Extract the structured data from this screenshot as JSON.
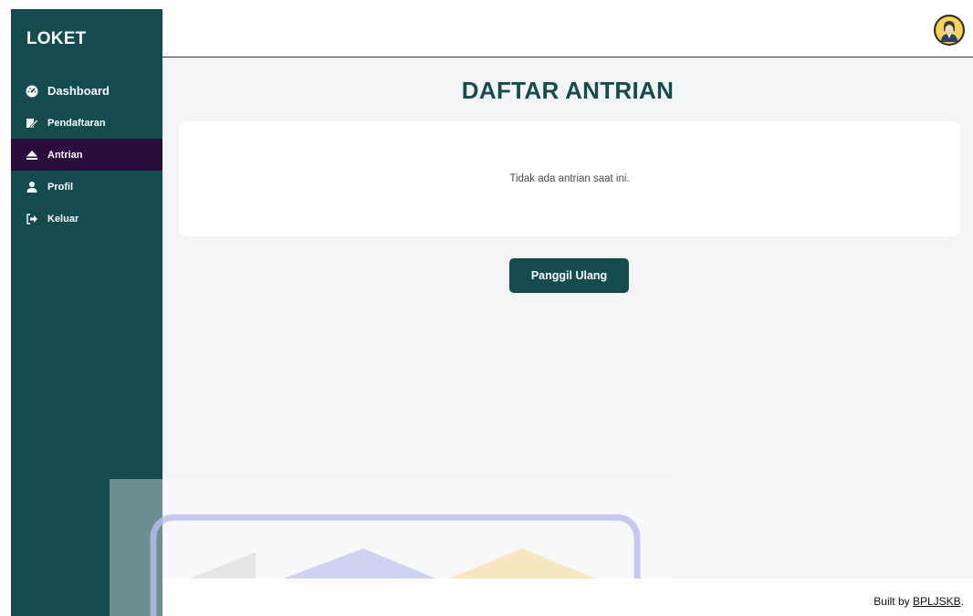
{
  "sidebar": {
    "brand": "LOKET",
    "items": [
      {
        "label": "Dashboard",
        "icon": "tachometer-icon"
      },
      {
        "label": "Pendaftaran",
        "icon": "edit-icon"
      },
      {
        "label": "Antrian",
        "icon": "eject-icon",
        "active": true
      },
      {
        "label": "Profil",
        "icon": "user-icon"
      },
      {
        "label": "Keluar",
        "icon": "sign-out-icon"
      }
    ]
  },
  "header": {
    "avatar_icon": "user-avatar-icon"
  },
  "main": {
    "title": "DAFTAR ANTRIAN",
    "empty_message": "Tidak ada antrian saat ini.",
    "recall_button": "Panggil Ulang"
  },
  "footer": {
    "prefix": "Built by ",
    "link": "BPLJSKB",
    "suffix": "."
  },
  "colors": {
    "sidebar": "#134b4f",
    "active": "#2b0b3c",
    "accent": "#134b4f",
    "background": "#f3f4f6"
  }
}
